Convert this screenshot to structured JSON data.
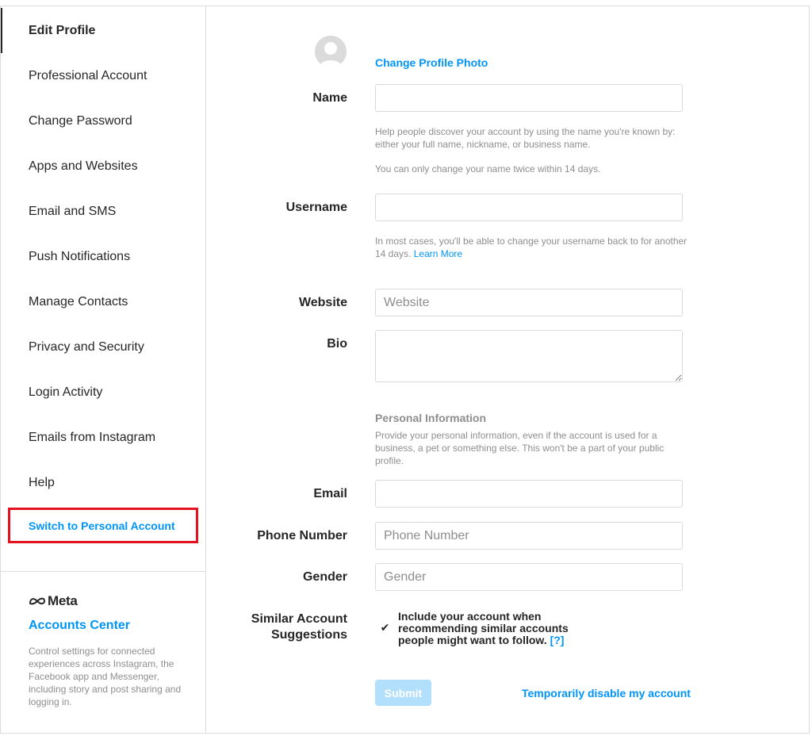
{
  "sidebar": {
    "items": [
      {
        "label": "Edit Profile",
        "name": "sidebar-item-edit-profile"
      },
      {
        "label": "Professional Account",
        "name": "sidebar-item-professional-account"
      },
      {
        "label": "Change Password",
        "name": "sidebar-item-change-password"
      },
      {
        "label": "Apps and Websites",
        "name": "sidebar-item-apps-and-websites"
      },
      {
        "label": "Email and SMS",
        "name": "sidebar-item-email-and-sms"
      },
      {
        "label": "Push Notifications",
        "name": "sidebar-item-push-notifications"
      },
      {
        "label": "Manage Contacts",
        "name": "sidebar-item-manage-contacts"
      },
      {
        "label": "Privacy and Security",
        "name": "sidebar-item-privacy-and-security"
      },
      {
        "label": "Login Activity",
        "name": "sidebar-item-login-activity"
      },
      {
        "label": "Emails from Instagram",
        "name": "sidebar-item-emails-from-instagram"
      },
      {
        "label": "Help",
        "name": "sidebar-item-help"
      }
    ],
    "active_index": 0,
    "switch_account_label": "Switch to Personal Account",
    "meta": {
      "logo_text": "Meta",
      "accounts_center_label": "Accounts Center",
      "description": "Control settings for connected experiences across Instagram, the Facebook app and Messenger, including story and post sharing and logging in."
    }
  },
  "profile": {
    "change_photo_label": "Change Profile Photo",
    "name": {
      "label": "Name",
      "value": "",
      "help": "Help people discover your account by using the name you're known by: either your full name, nickname, or business name.",
      "help2": "You can only change your name twice within 14 days."
    },
    "username": {
      "label": "Username",
      "value": "",
      "help": "In most cases, you'll be able to change your username back to for another 14 days.",
      "help_link": "Learn More"
    },
    "website": {
      "label": "Website",
      "value": "",
      "placeholder": "Website"
    },
    "bio": {
      "label": "Bio",
      "value": ""
    },
    "personal_info": {
      "title": "Personal Information",
      "description": "Provide your personal information, even if the account is used for a business, a pet or something else. This won't be a part of your public profile."
    },
    "email": {
      "label": "Email",
      "value": ""
    },
    "phone": {
      "label": "Phone Number",
      "value": "",
      "placeholder": "Phone Number"
    },
    "gender": {
      "label": "Gender",
      "value": "",
      "placeholder": "Gender"
    },
    "similar": {
      "label_line1": "Similar Account",
      "label_line2": "Suggestions",
      "checked": true,
      "text": "Include your account when recommending similar accounts people might want to follow.",
      "help_link": "[?]"
    },
    "submit_label": "Submit",
    "disable_label": "Temporarily disable my account"
  },
  "colors": {
    "accent": "#0095f6",
    "submit_disabled": "#b2dffc",
    "highlight_border": "#e3141f",
    "border": "#dbdbdb",
    "muted_text": "#8e8e8e"
  },
  "icons": {
    "avatar": "default-avatar-icon",
    "meta_logo": "meta-infinity-icon",
    "checkbox": "checkmark-icon"
  }
}
